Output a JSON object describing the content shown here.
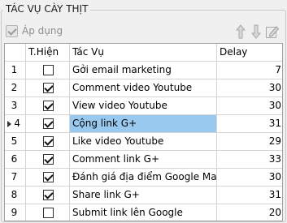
{
  "group": {
    "title": "TÁC VỤ CÀY THỊT"
  },
  "toolbar": {
    "apply_label": "Áp dụng",
    "apply_checked": true,
    "apply_disabled": true,
    "icons": [
      "arrow-up-icon",
      "arrow-down-icon",
      "edit-icon"
    ]
  },
  "table": {
    "columns": [
      "",
      "T.Hiện",
      "Tác Vụ",
      "Delay"
    ],
    "current_row": 4,
    "rows": [
      {
        "num": "1",
        "enabled": false,
        "task": "Gởi email marketing",
        "delay": "7"
      },
      {
        "num": "2",
        "enabled": true,
        "task": "Comment video Youtube",
        "delay": "30"
      },
      {
        "num": "3",
        "enabled": true,
        "task": "View video Youtube",
        "delay": "30"
      },
      {
        "num": "4",
        "enabled": true,
        "task": "Cộng link G+",
        "delay": "31"
      },
      {
        "num": "5",
        "enabled": true,
        "task": "Like video Youtube",
        "delay": "29"
      },
      {
        "num": "6",
        "enabled": true,
        "task": "Comment link G+",
        "delay": "33"
      },
      {
        "num": "7",
        "enabled": true,
        "task": "Đánh giá địa điểm Google Maps",
        "delay": "30"
      },
      {
        "num": "8",
        "enabled": true,
        "task": "Share link G+",
        "delay": "31"
      },
      {
        "num": "9",
        "enabled": false,
        "task": "Submit link lên Google",
        "delay": "20"
      }
    ]
  },
  "colors": {
    "selection": "#99c9ef",
    "border": "#a0a0a0",
    "background": "#f0f0f0"
  }
}
